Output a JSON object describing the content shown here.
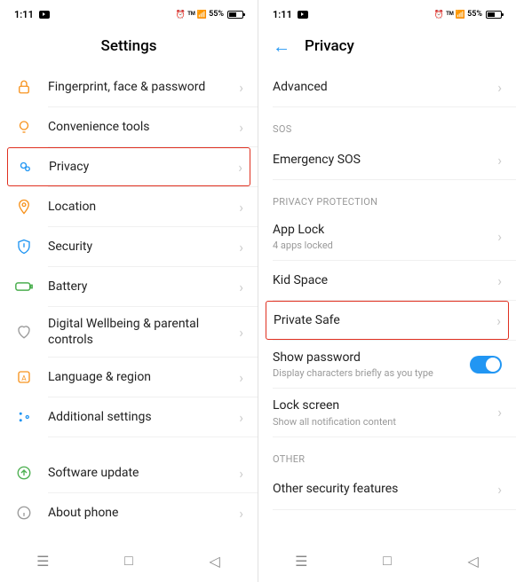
{
  "status": {
    "time": "1:11",
    "battery_pct": "55%",
    "indicators": "⏰ 7.00 ⬇ 📶"
  },
  "left": {
    "title": "Settings",
    "items": [
      {
        "label": "Fingerprint, face & password",
        "icon": "lock-icon",
        "color": "#f7931e"
      },
      {
        "label": "Convenience tools",
        "icon": "bulb-icon",
        "color": "#f7931e"
      },
      {
        "label": "Privacy",
        "icon": "privacy-icon",
        "color": "#2196f3",
        "highlighted": true
      },
      {
        "label": "Location",
        "icon": "location-icon",
        "color": "#f7931e"
      },
      {
        "label": "Security",
        "icon": "shield-icon",
        "color": "#2196f3"
      },
      {
        "label": "Battery",
        "icon": "battery-icon",
        "color": "#4caf50"
      },
      {
        "label": "Digital Wellbeing & parental controls",
        "icon": "heart-icon",
        "color": "#999"
      },
      {
        "label": "Language & region",
        "icon": "language-icon",
        "color": "#f7931e"
      },
      {
        "label": "Additional settings",
        "icon": "dots-icon",
        "color": "#2196f3"
      }
    ],
    "items2": [
      {
        "label": "Software update",
        "icon": "update-icon",
        "color": "#4caf50"
      },
      {
        "label": "About phone",
        "icon": "info-icon",
        "color": "#999"
      }
    ]
  },
  "right": {
    "title": "Privacy",
    "top_items": [
      {
        "label": "Advanced"
      }
    ],
    "sections": [
      {
        "header": "SOS",
        "items": [
          {
            "label": "Emergency SOS"
          }
        ]
      },
      {
        "header": "PRIVACY PROTECTION",
        "items": [
          {
            "label": "App Lock",
            "sub": "4 apps locked"
          },
          {
            "label": "Kid Space"
          },
          {
            "label": "Private Safe",
            "highlighted": true
          },
          {
            "label": "Show password",
            "sub": "Display characters briefly as you type",
            "toggle": true
          },
          {
            "label": "Lock screen",
            "sub": "Show all notification content"
          }
        ]
      },
      {
        "header": "OTHER",
        "items": [
          {
            "label": "Other security features"
          }
        ]
      }
    ]
  }
}
